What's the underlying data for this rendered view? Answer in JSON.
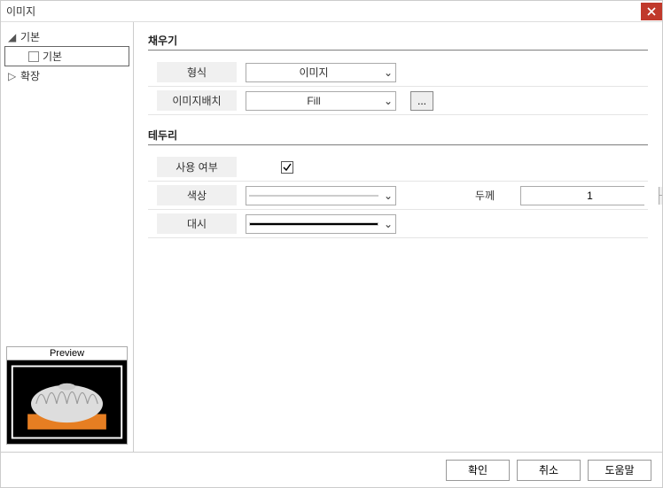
{
  "dialog": {
    "title": "이미지"
  },
  "tree": {
    "root": "기본",
    "child": "기본",
    "expand": "확장"
  },
  "preview": {
    "label": "Preview"
  },
  "sections": {
    "fill": "채우기",
    "border": "테두리"
  },
  "fields": {
    "format_label": "형식",
    "format_value": "이미지",
    "placement_label": "이미지배치",
    "placement_value": "Fill",
    "browse": "...",
    "enabled_label": "사용 여부",
    "enabled_checked": true,
    "color_label": "색상",
    "thickness_label": "두께",
    "thickness_value": "1",
    "dash_label": "대시"
  },
  "buttons": {
    "ok": "확인",
    "cancel": "취소",
    "help": "도움말"
  }
}
